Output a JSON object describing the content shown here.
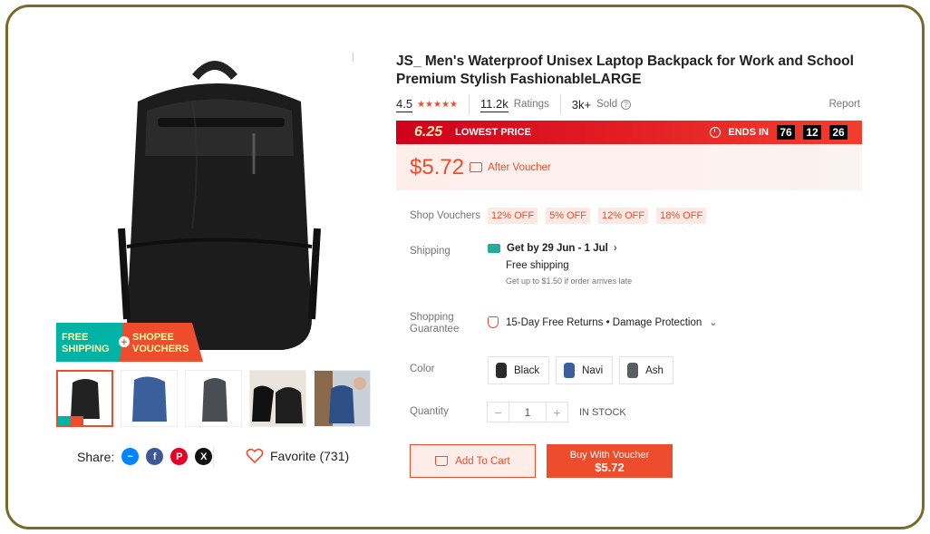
{
  "product": {
    "title": "JS_ Men's Waterproof Unisex Laptop Backpack for Work and School Premium Stylish FashionableLARGE",
    "rating": "4.5",
    "ratings_count": "11.2k",
    "ratings_label": "Ratings",
    "sold_count": "3k+",
    "sold_label": "Sold",
    "report_label": "Report"
  },
  "promo_banner": {
    "left_text": "FREE SHIPPING",
    "right_text": "SHOPEE VOUCHERS",
    "plus": "+"
  },
  "flash_sale": {
    "logo": "6.25",
    "label": "LOWEST PRICE",
    "ends_label": "ENDS IN",
    "timer": [
      "76",
      "12",
      "26"
    ]
  },
  "price": {
    "value": "$5.72",
    "note": "After Voucher"
  },
  "labels": {
    "shop_vouchers": "Shop Vouchers",
    "shipping": "Shipping",
    "shopping_guarantee_l1": "Shopping",
    "shopping_guarantee_l2": "Guarantee",
    "color": "Color",
    "quantity": "Quantity"
  },
  "vouchers": [
    "12% OFF",
    "5% OFF",
    "12% OFF",
    "18% OFF"
  ],
  "shipping": {
    "eta": "Get by 29 Jun - 1 Jul",
    "free": "Free shipping",
    "note": "Get up to $1.50 if order arrives late"
  },
  "guarantee": {
    "text": "15-Day Free Returns • Damage Protection"
  },
  "colors": [
    {
      "name": "Black",
      "swatch": "#2a2a2a"
    },
    {
      "name": "Navi",
      "swatch": "#3a5f9a"
    },
    {
      "name": "Ash",
      "swatch": "#5a5d62"
    }
  ],
  "quantity": {
    "minus": "−",
    "value": "1",
    "plus": "+",
    "stock": "IN STOCK"
  },
  "buttons": {
    "add_to_cart": "Add To Cart",
    "buy_line1": "Buy With Voucher",
    "buy_line2": "$5.72"
  },
  "share": {
    "label": "Share:",
    "favorite": "Favorite (731)"
  },
  "theme": {
    "accent": "#ee4d2d",
    "frame": "#7a6a2a"
  }
}
